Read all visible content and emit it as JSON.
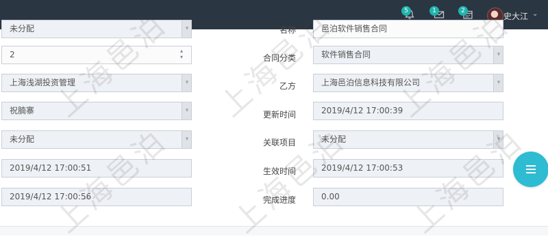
{
  "header": {
    "notifications_badge": "5",
    "messages_badge": "1",
    "calendar_badge": "2",
    "username": "史大江",
    "user_menu_caret": "⌄"
  },
  "form": {
    "left": [
      {
        "value": "未分配",
        "type": "select"
      },
      {
        "value": "2",
        "type": "number"
      },
      {
        "value": "上海浅湖投资管理",
        "type": "select"
      },
      {
        "value": "祝腩寨",
        "type": "select"
      },
      {
        "value": "未分配",
        "type": "select"
      },
      {
        "value": "2019/4/12 17:00:51",
        "type": "text"
      },
      {
        "value": "2019/4/12 17:00:56",
        "type": "text"
      }
    ],
    "right": [
      {
        "label": "名称",
        "value": "邑泊软件销售合同"
      },
      {
        "label": "合同分类",
        "value": "软件销售合同"
      },
      {
        "label": "乙方",
        "value": "上海邑泊信息科技有限公司"
      },
      {
        "label": "更新时间",
        "value": "2019/4/12 17:00:39"
      },
      {
        "label": "关联项目",
        "value": "未分配"
      },
      {
        "label": "生效时间",
        "value": "2019/4/12 17:00:53"
      },
      {
        "label": "完成进度",
        "value": "0.00"
      }
    ]
  },
  "watermark_text": "上海邑泊",
  "colors": {
    "topbar": "#2b3643",
    "badge": "#1fb5ad",
    "fab": "#2ebcd2",
    "field_bg": "#eef1f5"
  }
}
